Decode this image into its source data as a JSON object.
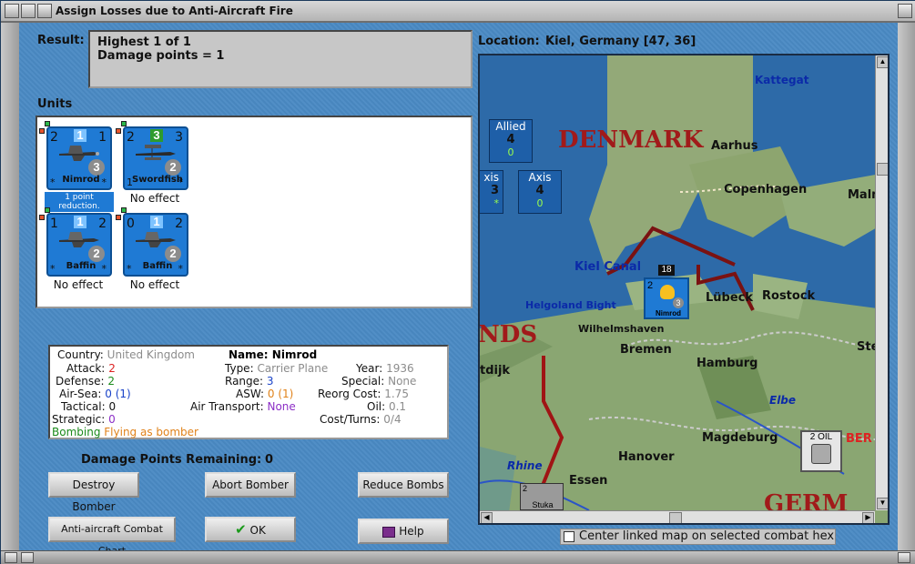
{
  "window": {
    "title": "Assign Losses due to Anti-Aircraft Fire"
  },
  "result": {
    "label": "Result:",
    "line1": "Highest 1 of 1",
    "line2": "Damage points = 1"
  },
  "units": {
    "label": "Units",
    "items": [
      {
        "name": "Nimrod",
        "left_num": "2",
        "top_num": "1",
        "right_num": "1",
        "circle": "3",
        "bottom_left": "*",
        "bottom_num": "*",
        "status": "1 point reduction.",
        "highlight": true
      },
      {
        "name": "Swordfish",
        "left_num": "2",
        "top_num": "3",
        "right_num": "3",
        "circle": "2",
        "bottom_left": "1",
        "bottom_num": "*",
        "status": "No effect",
        "highlight": false
      },
      {
        "name": "Baffin",
        "left_num": "1",
        "top_num": "1",
        "right_num": "2",
        "circle": "2",
        "bottom_left": "*",
        "bottom_num": "*",
        "status": "No effect",
        "highlight": false
      },
      {
        "name": "Baffin",
        "left_num": "0",
        "top_num": "1",
        "right_num": "2",
        "circle": "2",
        "bottom_left": "*",
        "bottom_num": "*",
        "status": "No effect",
        "highlight": false
      }
    ]
  },
  "info": {
    "country_label": "Country:",
    "country": "United Kingdom",
    "attack_label": "Attack:",
    "attack": "2",
    "defense_label": "Defense:",
    "defense": "2",
    "airsea_label": "Air-Sea:",
    "airsea": "0",
    "airsea_paren": "(1)",
    "tactical_label": "Tactical:",
    "tactical": "0",
    "strategic_label": "Strategic:",
    "strategic": "0",
    "mission_a": "Bombing",
    "mission_b": "Flying as bomber",
    "name_label": "Name:",
    "name": "Nimrod",
    "type_label": "Type:",
    "type": "Carrier Plane",
    "range_label": "Range:",
    "range": "3",
    "asw_label": "ASW:",
    "asw": "0",
    "asw_paren": "(1)",
    "airtransport_label": "Air Transport:",
    "airtransport": "None",
    "year_label": "Year:",
    "year": "1936",
    "special_label": "Special:",
    "special": "None",
    "reorg_label": "Reorg Cost:",
    "reorg": "1.75",
    "oil_label": "Oil:",
    "oil": "0.1",
    "costturns_label": "Cost/Turns:",
    "costturns": "0/4"
  },
  "damage": {
    "label": "Damage Points Remaining:",
    "value": "0"
  },
  "buttons": {
    "destroy": "Destroy Bomber",
    "abort": "Abort Bomber",
    "reduce": "Reduce Bombs",
    "chart": "Anti-aircraft Combat Chart",
    "ok": "OK",
    "help": "Help"
  },
  "location": {
    "label": "Location:",
    "value": "Kiel, Germany [47, 36]"
  },
  "map": {
    "panels": [
      {
        "title": "Allied",
        "value": "4",
        "sub": "0"
      },
      {
        "title": "Axis",
        "value": "4",
        "sub": "0"
      }
    ],
    "countries": {
      "denmark": "DENMARK",
      "nds": "NDS",
      "germ": "GERM",
      "ber": "BER"
    },
    "cities": [
      "Aarhus",
      "Copenhagen",
      "Malm",
      "Lübeck",
      "Rostock",
      "Bremen",
      "Hamburg",
      "Hanover",
      "Magdeburg",
      "Essen",
      "Wilhelmshaven",
      "tdijk",
      "Ste"
    ],
    "waters": {
      "kattegat": "Kattegat",
      "kiel": "Kiel Canal",
      "heligoland": "Helgoland Bight",
      "elbe": "Elbe",
      "rhine": "Rhine"
    },
    "partial_axis": {
      "title": "xis",
      "value": "3",
      "sub": "*"
    },
    "stack_number": "18",
    "counter_name": "Nimrod",
    "counter_left": "2",
    "counter_right": "3",
    "oil": "2 OIL",
    "stuka": "Stuka",
    "stuka_num": "2"
  },
  "checkbox": {
    "label": "Center linked map on selected combat hex",
    "checked": false
  }
}
